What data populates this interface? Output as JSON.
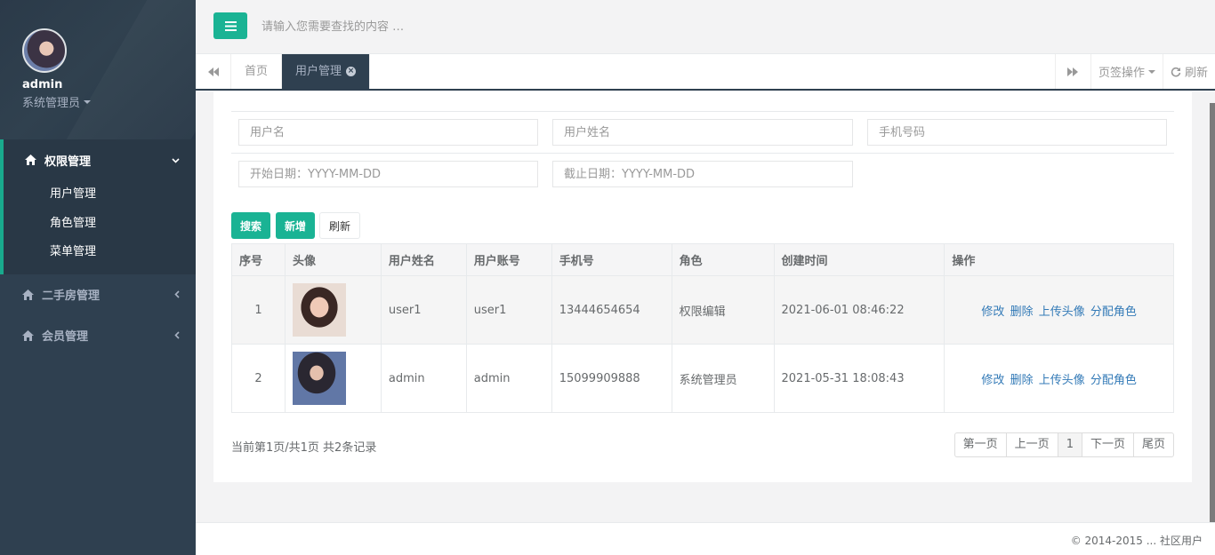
{
  "sidebar": {
    "profile": {
      "name": "admin",
      "role": "系统管理员"
    },
    "menus": [
      {
        "label": "权限管理",
        "icon": "home-icon",
        "expanded": true,
        "arrow": "⌄",
        "children": [
          {
            "label": "用户管理"
          },
          {
            "label": "角色管理"
          },
          {
            "label": "菜单管理"
          }
        ]
      },
      {
        "label": "二手房管理",
        "icon": "home-icon",
        "expanded": false,
        "arrow": "‹"
      },
      {
        "label": "会员管理",
        "icon": "home-icon",
        "expanded": false,
        "arrow": "‹"
      }
    ]
  },
  "topbar": {
    "search_placeholder": "请输入您需要查找的内容 …"
  },
  "tabs": {
    "items": [
      {
        "label": "首页",
        "active": false
      },
      {
        "label": "用户管理",
        "active": true
      }
    ],
    "close_symbol": "×",
    "actions_label": "页签操作",
    "refresh_label": "刷新"
  },
  "filters": {
    "username_placeholder": "用户名",
    "realname_placeholder": "用户姓名",
    "phone_placeholder": "手机号码",
    "start_date_placeholder": "开始日期：YYYY-MM-DD",
    "end_date_placeholder": "截止日期：YYYY-MM-DD"
  },
  "buttons": {
    "search": "搜索",
    "add": "新增",
    "refresh": "刷新"
  },
  "table": {
    "headers": [
      "序号",
      "头像",
      "用户姓名",
      "用户账号",
      "手机号",
      "角色",
      "创建时间",
      "操作"
    ],
    "rows": [
      {
        "index": "1",
        "avatar": "avatar-photo",
        "name": "user1",
        "account": "user1",
        "phone": "13444654654",
        "role": "权限编辑",
        "created": "2021-06-01 08:46:22"
      },
      {
        "index": "2",
        "avatar": "avatar-photo",
        "name": "admin",
        "account": "admin",
        "phone": "15099909888",
        "role": "系统管理员",
        "created": "2021-05-31 18:08:43"
      }
    ],
    "operations": [
      "修改",
      "删除",
      "上传头像",
      "分配角色"
    ]
  },
  "pagination": {
    "summary": "当前第1页/共1页  共2条记录",
    "first": "第一页",
    "prev": "上一页",
    "current": "1",
    "next": "下一页",
    "last": "尾页"
  },
  "footer": {
    "copyright": "© 2014-2015 ... 社区用户"
  },
  "colors": {
    "sidebar": "#2f4050",
    "accent": "#1ab394",
    "link": "#337ab7"
  }
}
